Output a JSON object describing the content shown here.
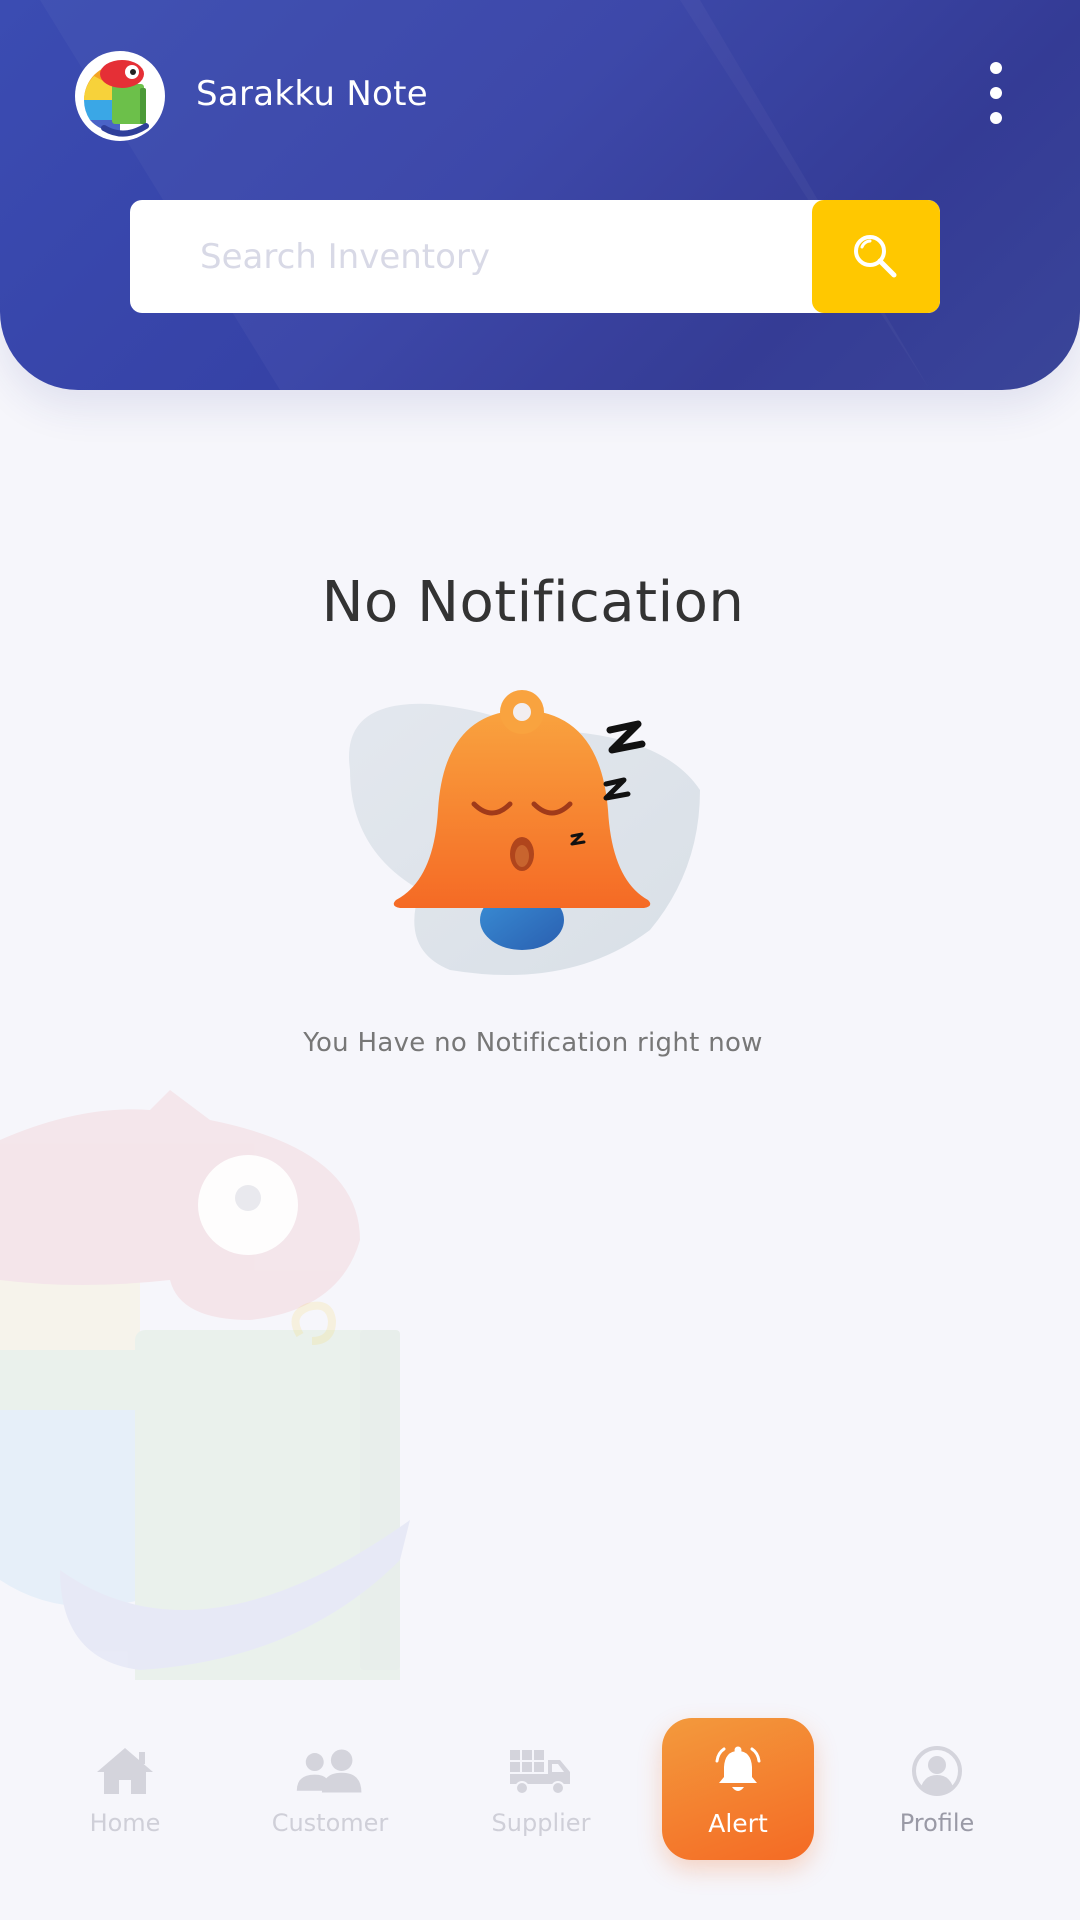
{
  "header": {
    "app_title": "Sarakku Note",
    "more_menu_icon": "more-vertical-icon",
    "logo": "chameleon-logo",
    "background_color": "#3642a6"
  },
  "search": {
    "placeholder": "Search Inventory",
    "value": "",
    "button_icon": "search-icon",
    "button_color": "#ffc800"
  },
  "empty_state": {
    "title": "No Notification",
    "illustration": "sleeping-bell-icon",
    "message": "You Have no Notification right now"
  },
  "bottom_nav": {
    "items": [
      {
        "label": "Home",
        "icon": "home-icon",
        "active": false
      },
      {
        "label": "Customer",
        "icon": "customer-icon",
        "active": false
      },
      {
        "label": "Supplier",
        "icon": "truck-icon",
        "active": false
      },
      {
        "label": "Alert",
        "icon": "bell-icon",
        "active": true
      },
      {
        "label": "Profile",
        "icon": "profile-icon",
        "active": false
      }
    ],
    "active_color": "#f46a24"
  }
}
